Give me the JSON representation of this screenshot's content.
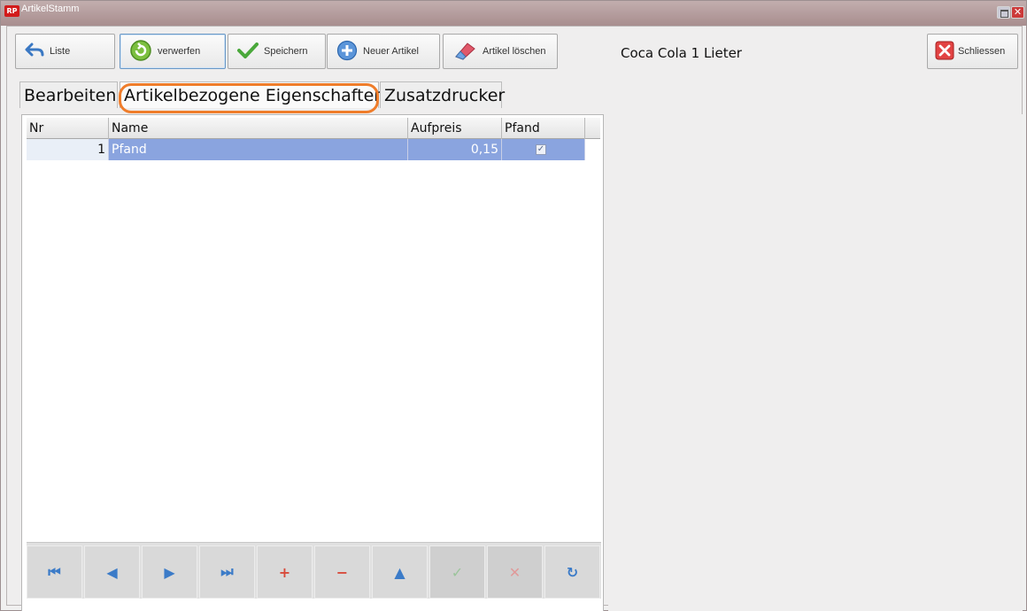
{
  "window": {
    "title": "ArtikelStamm",
    "app_icon_text": "RP",
    "close_glyph": "✕"
  },
  "toolbar": {
    "liste_label": "Liste",
    "verwerfen_label": "verwerfen",
    "speichern_label": "Speichern",
    "neuer_artikel_label": "Neuer Artikel",
    "artikel_loeschen_label": "Artikel löschen",
    "schliessen_label": "Schliessen"
  },
  "record": {
    "title": "Coca Cola 1 Lieter"
  },
  "tabs": [
    {
      "label": "Bearbeiten",
      "selected": false
    },
    {
      "label": "Artikelbezogene Eigenschaften",
      "selected": true
    },
    {
      "label": "Zusatzdrucker",
      "selected": false
    }
  ],
  "grid": {
    "columns": [
      "Nr",
      "Name",
      "Aufpreis",
      "Pfand"
    ],
    "rows": [
      {
        "nr": "1",
        "name": "Pfand",
        "aufpreis": "0,15",
        "pfand": true
      }
    ]
  },
  "navigator": {
    "buttons": [
      {
        "name": "first",
        "glyph": "⏮",
        "color": "#3b7bc8",
        "enabled": true
      },
      {
        "name": "prior",
        "glyph": "◀",
        "color": "#3b7bc8",
        "enabled": true
      },
      {
        "name": "next",
        "glyph": "▶",
        "color": "#3b7bc8",
        "enabled": true
      },
      {
        "name": "last",
        "glyph": "⏭",
        "color": "#3b7bc8",
        "enabled": true
      },
      {
        "name": "insert",
        "glyph": "+",
        "color": "#d84a3a",
        "enabled": true
      },
      {
        "name": "delete",
        "glyph": "−",
        "color": "#d84a3a",
        "enabled": true
      },
      {
        "name": "edit",
        "glyph": "▲",
        "color": "#3b7bc8",
        "enabled": true
      },
      {
        "name": "post",
        "glyph": "✓",
        "color": "#9bc49b",
        "enabled": false
      },
      {
        "name": "cancel",
        "glyph": "✕",
        "color": "#e09a9a",
        "enabled": false
      },
      {
        "name": "refresh",
        "glyph": "↻",
        "color": "#3b7bc8",
        "enabled": true
      }
    ]
  },
  "colors": {
    "selection": "#8aa4df",
    "highlight_ring": "#ef7d2b"
  }
}
